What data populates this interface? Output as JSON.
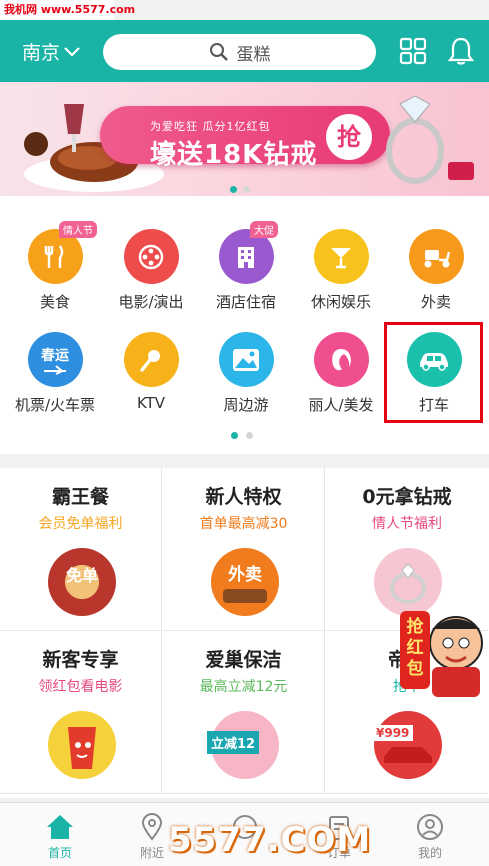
{
  "watermark": {
    "top": "我机网 www.5577.com",
    "bottom": "5577.COM"
  },
  "header": {
    "city": "南京",
    "search_placeholder": "蛋糕"
  },
  "banner": {
    "subtitle": "为爱吃狂 瓜分1亿红包",
    "title": "壕送18K钻戒",
    "button": "抢"
  },
  "categories": [
    {
      "label": "美食",
      "tag": "情人节",
      "color": "#f7a11a"
    },
    {
      "label": "电影/演出",
      "tag": "",
      "color": "#ee4b4b"
    },
    {
      "label": "酒店住宿",
      "tag": "大促",
      "color": "#9b59d0"
    },
    {
      "label": "休闲娱乐",
      "tag": "",
      "color": "#f8c21c"
    },
    {
      "label": "外卖",
      "tag": "",
      "color": "#f79a1c"
    },
    {
      "label": "机票/火车票",
      "tag": "",
      "color": "#2e8fe0",
      "icon_text": "春运"
    },
    {
      "label": "KTV",
      "tag": "",
      "color": "#f7b21a"
    },
    {
      "label": "周边游",
      "tag": "",
      "color": "#2bb5e8"
    },
    {
      "label": "丽人/美发",
      "tag": "",
      "color": "#f04f8f"
    },
    {
      "label": "打车",
      "tag": "",
      "color": "#1bc0ad"
    }
  ],
  "promos": [
    {
      "title": "霸王餐",
      "subtitle": "会员免单福利",
      "sub_color": "#f5a623",
      "img_text": "免单",
      "img_color": "#c0392b"
    },
    {
      "title": "新人特权",
      "subtitle": "首单最高减30",
      "sub_color": "#f07c1e",
      "img_text": "外卖",
      "img_color": "#f07c1e"
    },
    {
      "title": "0元拿钻戒",
      "subtitle": "情人节福利",
      "sub_color": "#e84a7f",
      "img_text": "",
      "img_color": "#f7c6d3"
    },
    {
      "title": "新客专享",
      "subtitle": "领红包看电影",
      "sub_color": "#e84a7f",
      "img_text": "",
      "img_color": "#f5d13b"
    },
    {
      "title": "爱巢保洁",
      "subtitle": "最高立减12元",
      "sub_color": "#5cb85c",
      "img_text": "立减12",
      "img_color": "#f7b6c6"
    },
    {
      "title": "帝豪",
      "subtitle": "抢千",
      "sub_color": "#19b4a6",
      "img_text": "¥999",
      "img_color": "#e23b3b"
    }
  ],
  "hongbao_text": "抢红包",
  "tabs": [
    {
      "label": "首页",
      "active": true
    },
    {
      "label": "附近",
      "active": false
    },
    {
      "label": "",
      "active": false
    },
    {
      "label": "订单",
      "active": false
    },
    {
      "label": "我的",
      "active": false
    }
  ]
}
